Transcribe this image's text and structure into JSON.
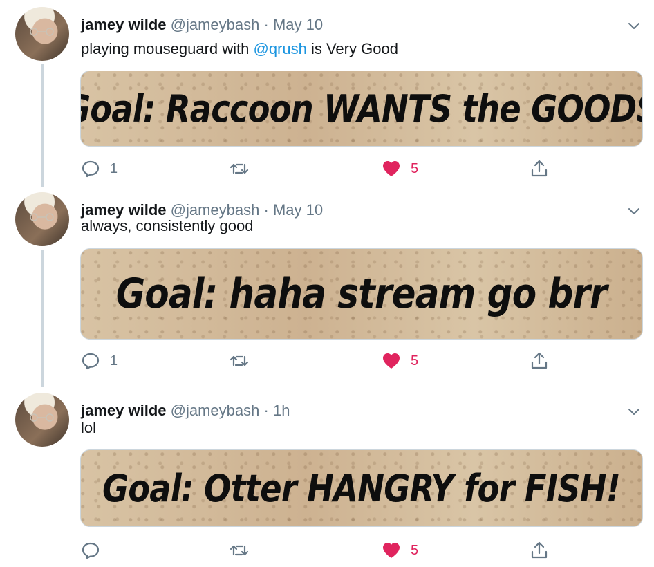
{
  "tweets": [
    {
      "name": "jamey wilde",
      "handle": "@jameybash",
      "separator": "·",
      "time": "May 10",
      "text_before": "playing mouseguard with ",
      "mention": "@qrush",
      "text_after": " is Very Good",
      "media_text": "Goal: Raccoon WANTS the GOODS",
      "reply_count": "1",
      "retweet_count": "",
      "like_count": "5"
    },
    {
      "name": "jamey wilde",
      "handle": "@jameybash",
      "separator": "·",
      "time": "May 10",
      "text_before": "always, consistently good",
      "mention": "",
      "text_after": "",
      "media_text": "Goal: haha stream go brr",
      "reply_count": "1",
      "retweet_count": "",
      "like_count": "5"
    },
    {
      "name": "jamey wilde",
      "handle": "@jameybash",
      "separator": "·",
      "time": "1h",
      "text_before": "lol",
      "mention": "",
      "text_after": "",
      "media_text": "Goal: Otter HANGRY for FISH!",
      "reply_count": "",
      "retweet_count": "",
      "like_count": "5"
    }
  ],
  "icons": {
    "reply": "reply-icon",
    "retweet": "retweet-icon",
    "like": "heart-icon",
    "share": "share-icon",
    "more": "chevron-down-icon"
  },
  "colors": {
    "text": "#14171a",
    "secondary": "#657786",
    "link": "#1b95e0",
    "like": "#e0245e",
    "thread_line": "#ccd6dd"
  }
}
